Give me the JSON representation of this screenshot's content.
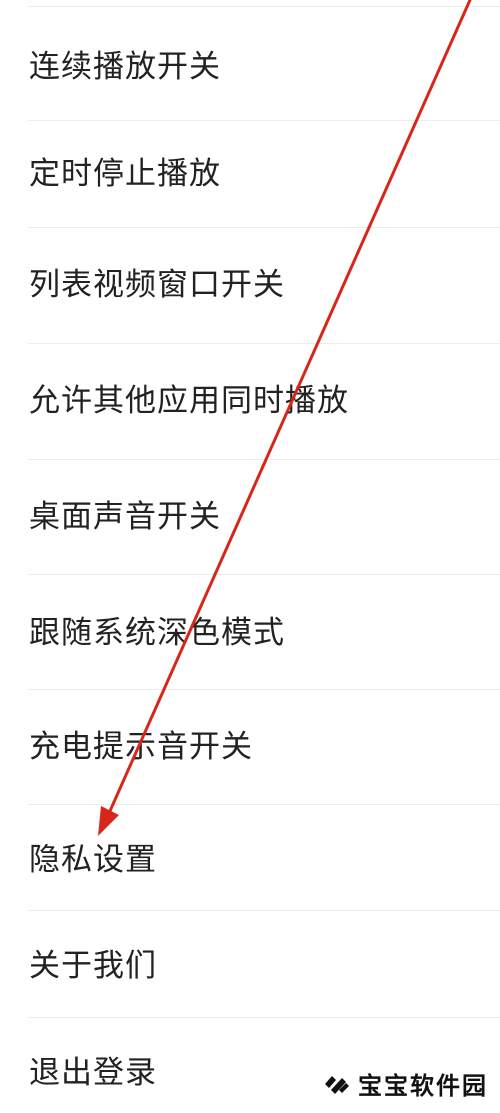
{
  "settings": {
    "items": [
      {
        "label": "连续播放开关"
      },
      {
        "label": "定时停止播放"
      },
      {
        "label": "列表视频窗口开关"
      },
      {
        "label": "允许其他应用同时播放"
      },
      {
        "label": "桌面声音开关"
      },
      {
        "label": "跟随系统深色模式"
      },
      {
        "label": "充电提示音开关"
      },
      {
        "label": "隐私设置"
      },
      {
        "label": "关于我们"
      },
      {
        "label": "退出登录"
      }
    ]
  },
  "annotation": {
    "arrow_color": "#d9261c",
    "target": "隐私设置"
  },
  "watermark": {
    "text": "宝宝软件园",
    "icon": "diamond-logo-icon"
  }
}
